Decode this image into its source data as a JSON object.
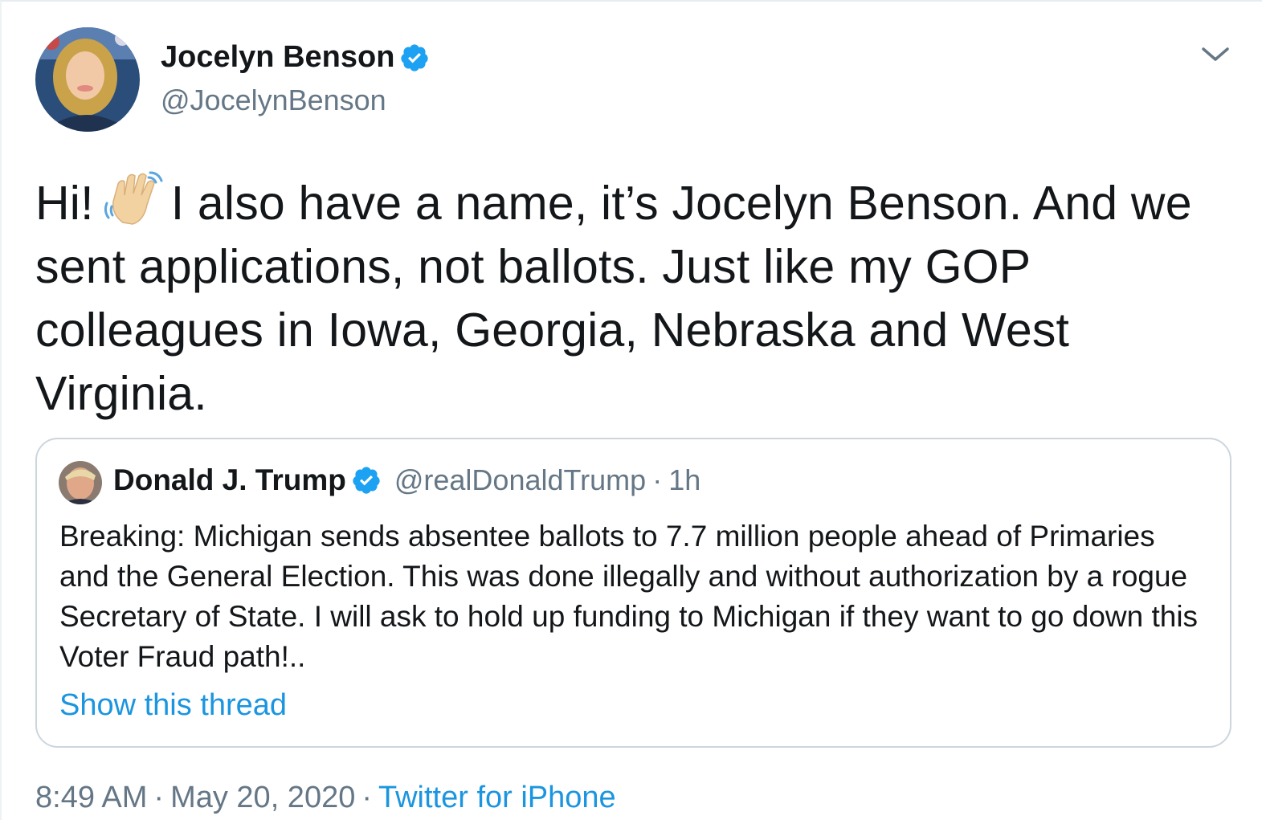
{
  "author": {
    "name": "Jocelyn Benson",
    "handle": "@JocelynBenson",
    "verified": true
  },
  "tweet": {
    "text_part1": "Hi!",
    "emoji": "waving-hand-emoji",
    "text_part2": "I also have a name, it’s Jocelyn Benson. And we sent applications, not ballots. Just like my GOP colleagues in Iowa, Georgia, Nebraska and West Virginia."
  },
  "quoted_tweet": {
    "name": "Donald J. Trump",
    "handle": "@realDonaldTrump",
    "separator": "·",
    "time": "1h",
    "text": "Breaking: Michigan sends absentee ballots to 7.7 million people ahead of Primaries and the General Election. This was done illegally and without authorization by a rogue Secretary of State. I will ask to hold up funding to Michigan if they want to go down this Voter Fraud path!..",
    "show_thread": "Show this thread"
  },
  "meta": {
    "time": "8:49 AM",
    "date": "May 20, 2020",
    "separator": "·",
    "source": "Twitter for iPhone"
  },
  "colors": {
    "link": "#1b95e0",
    "verified": "#1da1f2",
    "secondary_text": "#657786",
    "border": "#ccd6dd"
  }
}
